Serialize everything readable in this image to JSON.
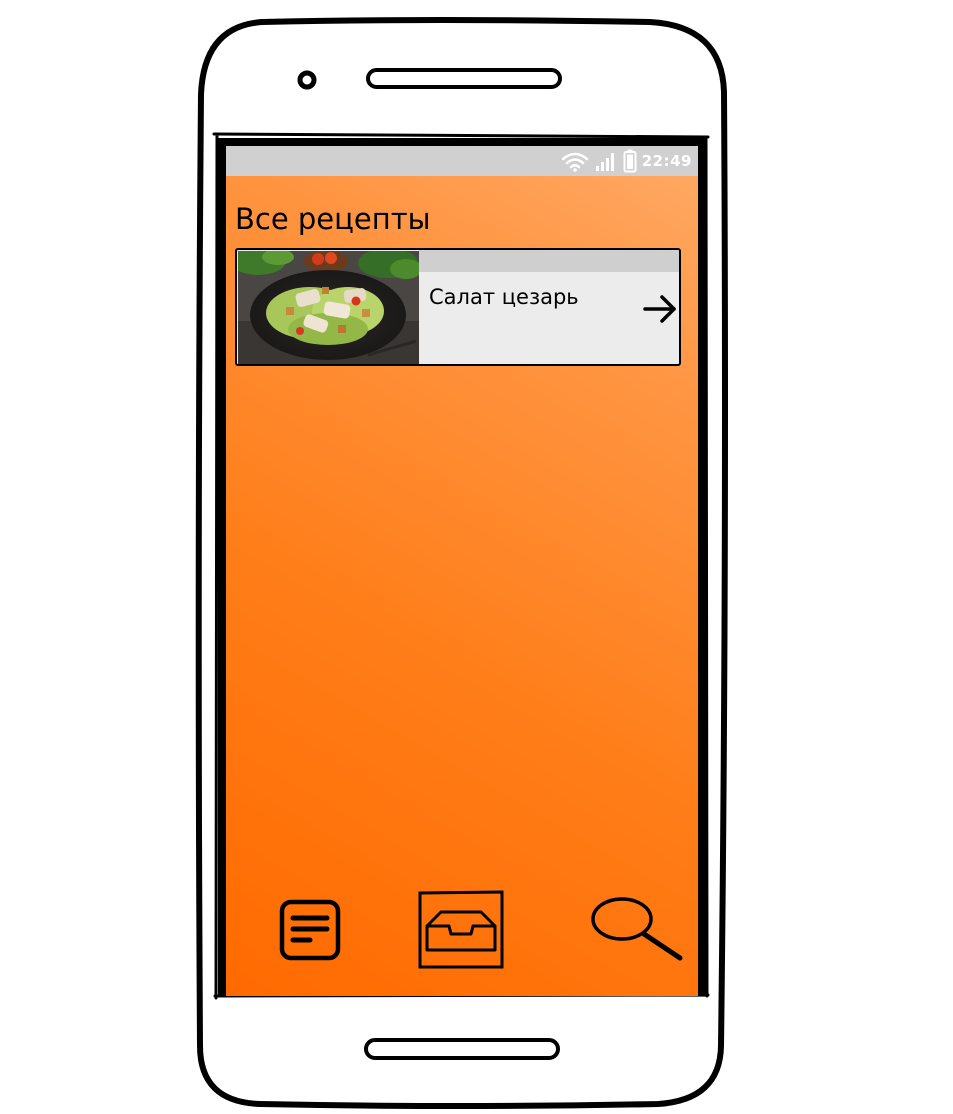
{
  "status_bar": {
    "time": "22:49",
    "icons": [
      "wifi-icon",
      "signal-icon",
      "battery-icon"
    ]
  },
  "page": {
    "title": "Все рецепты"
  },
  "recipes": [
    {
      "name": "Салат цезарь",
      "image": "caesar-salad-photo",
      "action_icon": "arrow-right-icon"
    }
  ],
  "bottom_nav": {
    "items": [
      "list-icon",
      "inbox-icon",
      "search-icon"
    ]
  },
  "colors": {
    "screen_gradient_start": "#ff6a00",
    "screen_gradient_end": "#ffaa66",
    "status_bar": "#d0d0d0",
    "card_background": "#ececec"
  }
}
